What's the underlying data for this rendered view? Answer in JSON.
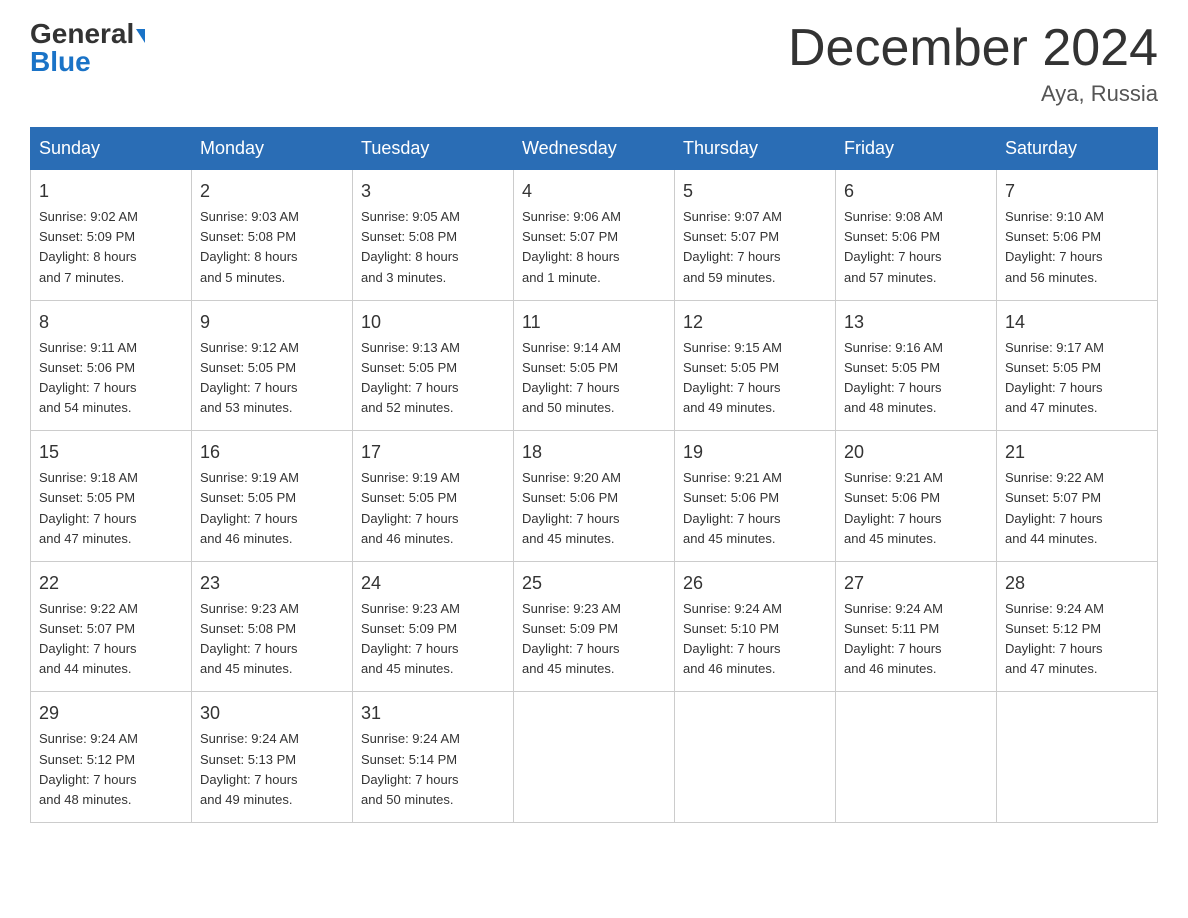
{
  "logo": {
    "part1": "General",
    "part2": "Blue"
  },
  "header": {
    "month_year": "December 2024",
    "location": "Aya, Russia"
  },
  "weekdays": [
    "Sunday",
    "Monday",
    "Tuesday",
    "Wednesday",
    "Thursday",
    "Friday",
    "Saturday"
  ],
  "weeks": [
    [
      {
        "day": "1",
        "sunrise": "9:02 AM",
        "sunset": "5:09 PM",
        "daylight": "8 hours and 7 minutes."
      },
      {
        "day": "2",
        "sunrise": "9:03 AM",
        "sunset": "5:08 PM",
        "daylight": "8 hours and 5 minutes."
      },
      {
        "day": "3",
        "sunrise": "9:05 AM",
        "sunset": "5:08 PM",
        "daylight": "8 hours and 3 minutes."
      },
      {
        "day": "4",
        "sunrise": "9:06 AM",
        "sunset": "5:07 PM",
        "daylight": "8 hours and 1 minute."
      },
      {
        "day": "5",
        "sunrise": "9:07 AM",
        "sunset": "5:07 PM",
        "daylight": "7 hours and 59 minutes."
      },
      {
        "day": "6",
        "sunrise": "9:08 AM",
        "sunset": "5:06 PM",
        "daylight": "7 hours and 57 minutes."
      },
      {
        "day": "7",
        "sunrise": "9:10 AM",
        "sunset": "5:06 PM",
        "daylight": "7 hours and 56 minutes."
      }
    ],
    [
      {
        "day": "8",
        "sunrise": "9:11 AM",
        "sunset": "5:06 PM",
        "daylight": "7 hours and 54 minutes."
      },
      {
        "day": "9",
        "sunrise": "9:12 AM",
        "sunset": "5:05 PM",
        "daylight": "7 hours and 53 minutes."
      },
      {
        "day": "10",
        "sunrise": "9:13 AM",
        "sunset": "5:05 PM",
        "daylight": "7 hours and 52 minutes."
      },
      {
        "day": "11",
        "sunrise": "9:14 AM",
        "sunset": "5:05 PM",
        "daylight": "7 hours and 50 minutes."
      },
      {
        "day": "12",
        "sunrise": "9:15 AM",
        "sunset": "5:05 PM",
        "daylight": "7 hours and 49 minutes."
      },
      {
        "day": "13",
        "sunrise": "9:16 AM",
        "sunset": "5:05 PM",
        "daylight": "7 hours and 48 minutes."
      },
      {
        "day": "14",
        "sunrise": "9:17 AM",
        "sunset": "5:05 PM",
        "daylight": "7 hours and 47 minutes."
      }
    ],
    [
      {
        "day": "15",
        "sunrise": "9:18 AM",
        "sunset": "5:05 PM",
        "daylight": "7 hours and 47 minutes."
      },
      {
        "day": "16",
        "sunrise": "9:19 AM",
        "sunset": "5:05 PM",
        "daylight": "7 hours and 46 minutes."
      },
      {
        "day": "17",
        "sunrise": "9:19 AM",
        "sunset": "5:05 PM",
        "daylight": "7 hours and 46 minutes."
      },
      {
        "day": "18",
        "sunrise": "9:20 AM",
        "sunset": "5:06 PM",
        "daylight": "7 hours and 45 minutes."
      },
      {
        "day": "19",
        "sunrise": "9:21 AM",
        "sunset": "5:06 PM",
        "daylight": "7 hours and 45 minutes."
      },
      {
        "day": "20",
        "sunrise": "9:21 AM",
        "sunset": "5:06 PM",
        "daylight": "7 hours and 45 minutes."
      },
      {
        "day": "21",
        "sunrise": "9:22 AM",
        "sunset": "5:07 PM",
        "daylight": "7 hours and 44 minutes."
      }
    ],
    [
      {
        "day": "22",
        "sunrise": "9:22 AM",
        "sunset": "5:07 PM",
        "daylight": "7 hours and 44 minutes."
      },
      {
        "day": "23",
        "sunrise": "9:23 AM",
        "sunset": "5:08 PM",
        "daylight": "7 hours and 45 minutes."
      },
      {
        "day": "24",
        "sunrise": "9:23 AM",
        "sunset": "5:09 PM",
        "daylight": "7 hours and 45 minutes."
      },
      {
        "day": "25",
        "sunrise": "9:23 AM",
        "sunset": "5:09 PM",
        "daylight": "7 hours and 45 minutes."
      },
      {
        "day": "26",
        "sunrise": "9:24 AM",
        "sunset": "5:10 PM",
        "daylight": "7 hours and 46 minutes."
      },
      {
        "day": "27",
        "sunrise": "9:24 AM",
        "sunset": "5:11 PM",
        "daylight": "7 hours and 46 minutes."
      },
      {
        "day": "28",
        "sunrise": "9:24 AM",
        "sunset": "5:12 PM",
        "daylight": "7 hours and 47 minutes."
      }
    ],
    [
      {
        "day": "29",
        "sunrise": "9:24 AM",
        "sunset": "5:12 PM",
        "daylight": "7 hours and 48 minutes."
      },
      {
        "day": "30",
        "sunrise": "9:24 AM",
        "sunset": "5:13 PM",
        "daylight": "7 hours and 49 minutes."
      },
      {
        "day": "31",
        "sunrise": "9:24 AM",
        "sunset": "5:14 PM",
        "daylight": "7 hours and 50 minutes."
      },
      null,
      null,
      null,
      null
    ]
  ]
}
